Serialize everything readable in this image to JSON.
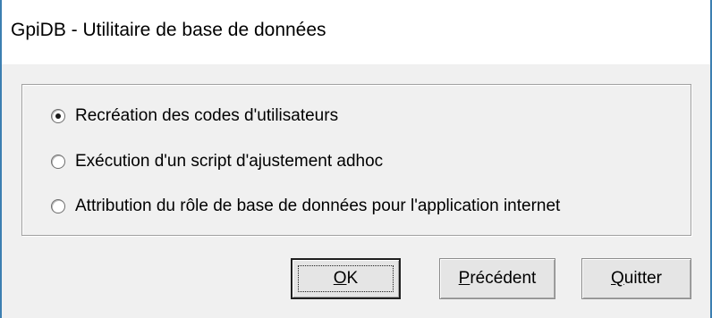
{
  "window": {
    "title": "GpiDB - Utilitaire de base de données"
  },
  "options": [
    {
      "label": "Recréation des codes d'utilisateurs",
      "selected": true
    },
    {
      "label": "Exécution d'un script d'ajustement adhoc",
      "selected": false
    },
    {
      "label": "Attribution du rôle de base de données pour l'application internet",
      "selected": false
    }
  ],
  "buttons": {
    "ok": {
      "mnemonic": "O",
      "rest": "K"
    },
    "previous": {
      "mnemonic": "P",
      "rest": "récédent"
    },
    "quit": {
      "mnemonic": "Q",
      "rest": "uitter"
    }
  },
  "colors": {
    "window_border": "#3c7fb1",
    "dialog_background": "#f0f0f0",
    "button_background": "#e5e5e5"
  }
}
